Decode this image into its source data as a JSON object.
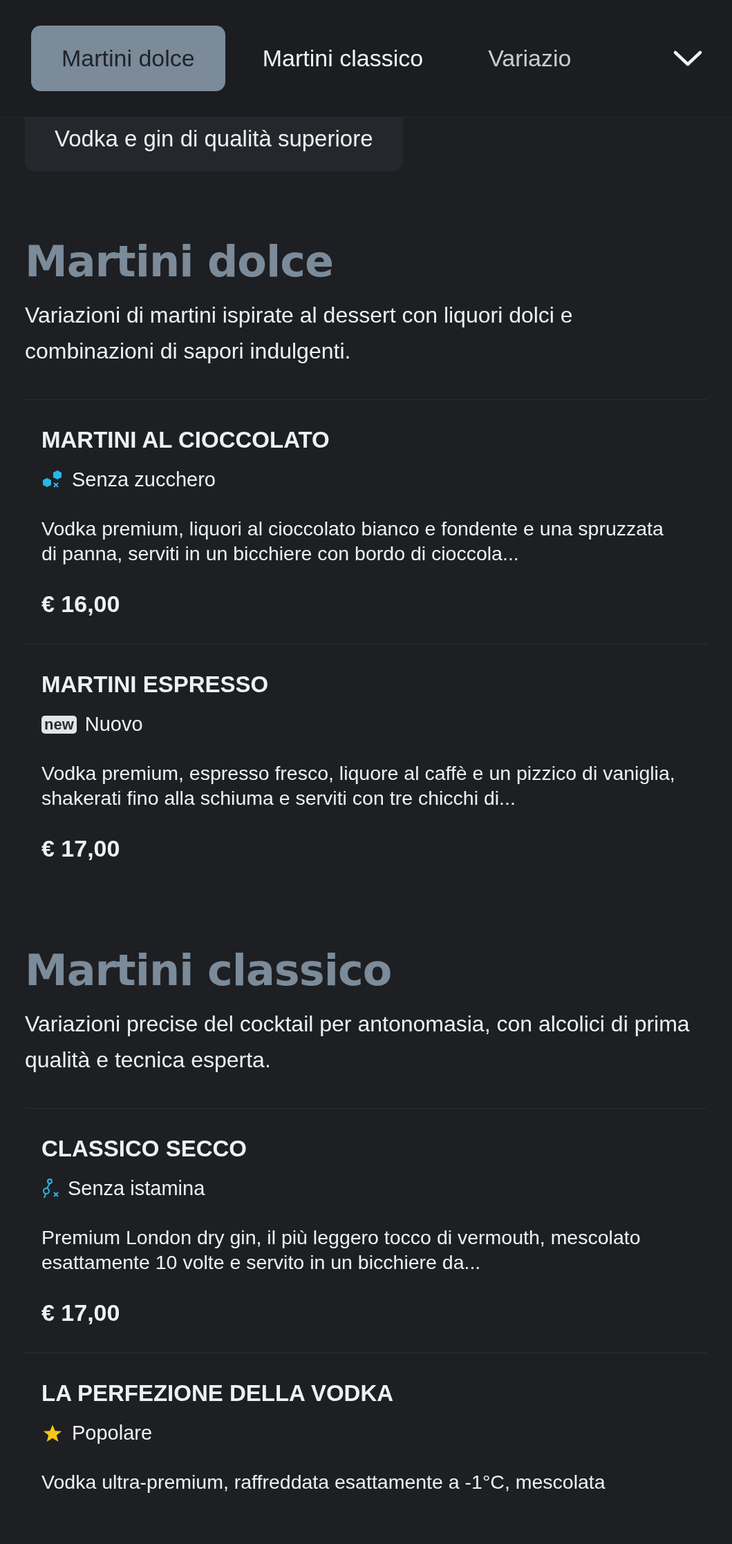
{
  "tabs": [
    {
      "label": "Martini dolce",
      "selected": true
    },
    {
      "label": "Martini classico",
      "selected": false
    },
    {
      "label": "Variazio",
      "selected": false
    }
  ],
  "subcategory": "Vodka e gin di qualità superiore",
  "sections": [
    {
      "title": "Martini dolce",
      "description": "Variazioni di martini ispirate al dessert con liquori dolci e combinazioni di sapori indulgenti.",
      "items": [
        {
          "name": "MARTINI AL CIOCCOLATO",
          "tag": {
            "kind": "sugar_free",
            "label": "Senza zucchero"
          },
          "description": "Vodka premium, liquori al cioccolato bianco e fondente e una spruzzata di panna, serviti in un bicchiere con bordo di cioccola...",
          "price": "€ 16,00"
        },
        {
          "name": "MARTINI ESPRESSO",
          "tag": {
            "kind": "new",
            "badge": "new",
            "label": "Nuovo"
          },
          "description": "Vodka premium, espresso fresco, liquore al caffè e un pizzico di vaniglia, shakerati fino alla schiuma e serviti con tre chicchi di...",
          "price": "€ 17,00"
        }
      ]
    },
    {
      "title": "Martini classico",
      "description": "Variazioni precise del cocktail per antonomasia, con alcolici di prima qualità e tecnica esperta.",
      "items": [
        {
          "name": "CLASSICO SECCO",
          "tag": {
            "kind": "histamine_free",
            "label": "Senza istamina"
          },
          "description": "Premium London dry gin, il più leggero tocco di vermouth, mescolato esattamente 10 volte e servito in un bicchiere da...",
          "price": "€ 17,00"
        },
        {
          "name": "LA PERFEZIONE DELLA VODKA",
          "tag": {
            "kind": "popular",
            "label": "Popolare"
          },
          "description": "Vodka ultra-premium, raffreddata esattamente a -1°C, mescolata"
        }
      ]
    }
  ]
}
